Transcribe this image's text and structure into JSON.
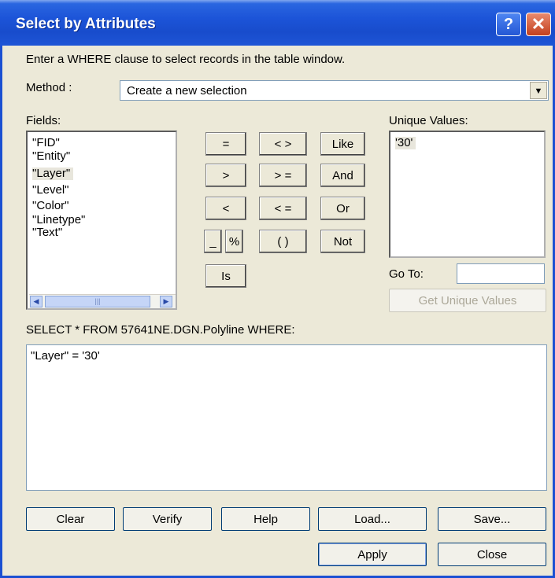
{
  "window": {
    "title": "Select by Attributes",
    "help_glyph": "?",
    "close_glyph": "✕"
  },
  "instruction": "Enter a WHERE clause to select records in the table window.",
  "method": {
    "label": "Method :",
    "value": "Create a new selection"
  },
  "fields": {
    "label": "Fields:",
    "items": [
      "\"FID\"",
      "\"Entity\"",
      "\"Layer\"",
      "\"Level\"",
      "\"Color\"",
      "\"Linetype\"",
      "\"Text\""
    ],
    "selected": "\"Layer\""
  },
  "operators": {
    "eq": "=",
    "ne": "< >",
    "like": "Like",
    "gt": ">",
    "ge": "> =",
    "and": "And",
    "lt": "<",
    "le": "< =",
    "or": "Or",
    "underscore": "_",
    "percent": "%",
    "parens": "( )",
    "not": "Not",
    "is": "Is"
  },
  "unique_values": {
    "label": "Unique Values:",
    "items": [
      "'30'"
    ]
  },
  "goto": {
    "label": "Go To:",
    "value": ""
  },
  "get_unique_values_label": "Get Unique Values",
  "query_header": "SELECT * FROM 57641NE.DGN.Polyline WHERE:",
  "query_text": "\"Layer\" = '30'",
  "buttons": {
    "clear": "Clear",
    "verify": "Verify",
    "help": "Help",
    "load": "Load...",
    "save": "Save...",
    "apply": "Apply",
    "close": "Close"
  },
  "icons": {
    "dropdown": "▼",
    "scroll_left": "◀",
    "scroll_right": "▶",
    "thumb_grip": "|||"
  }
}
